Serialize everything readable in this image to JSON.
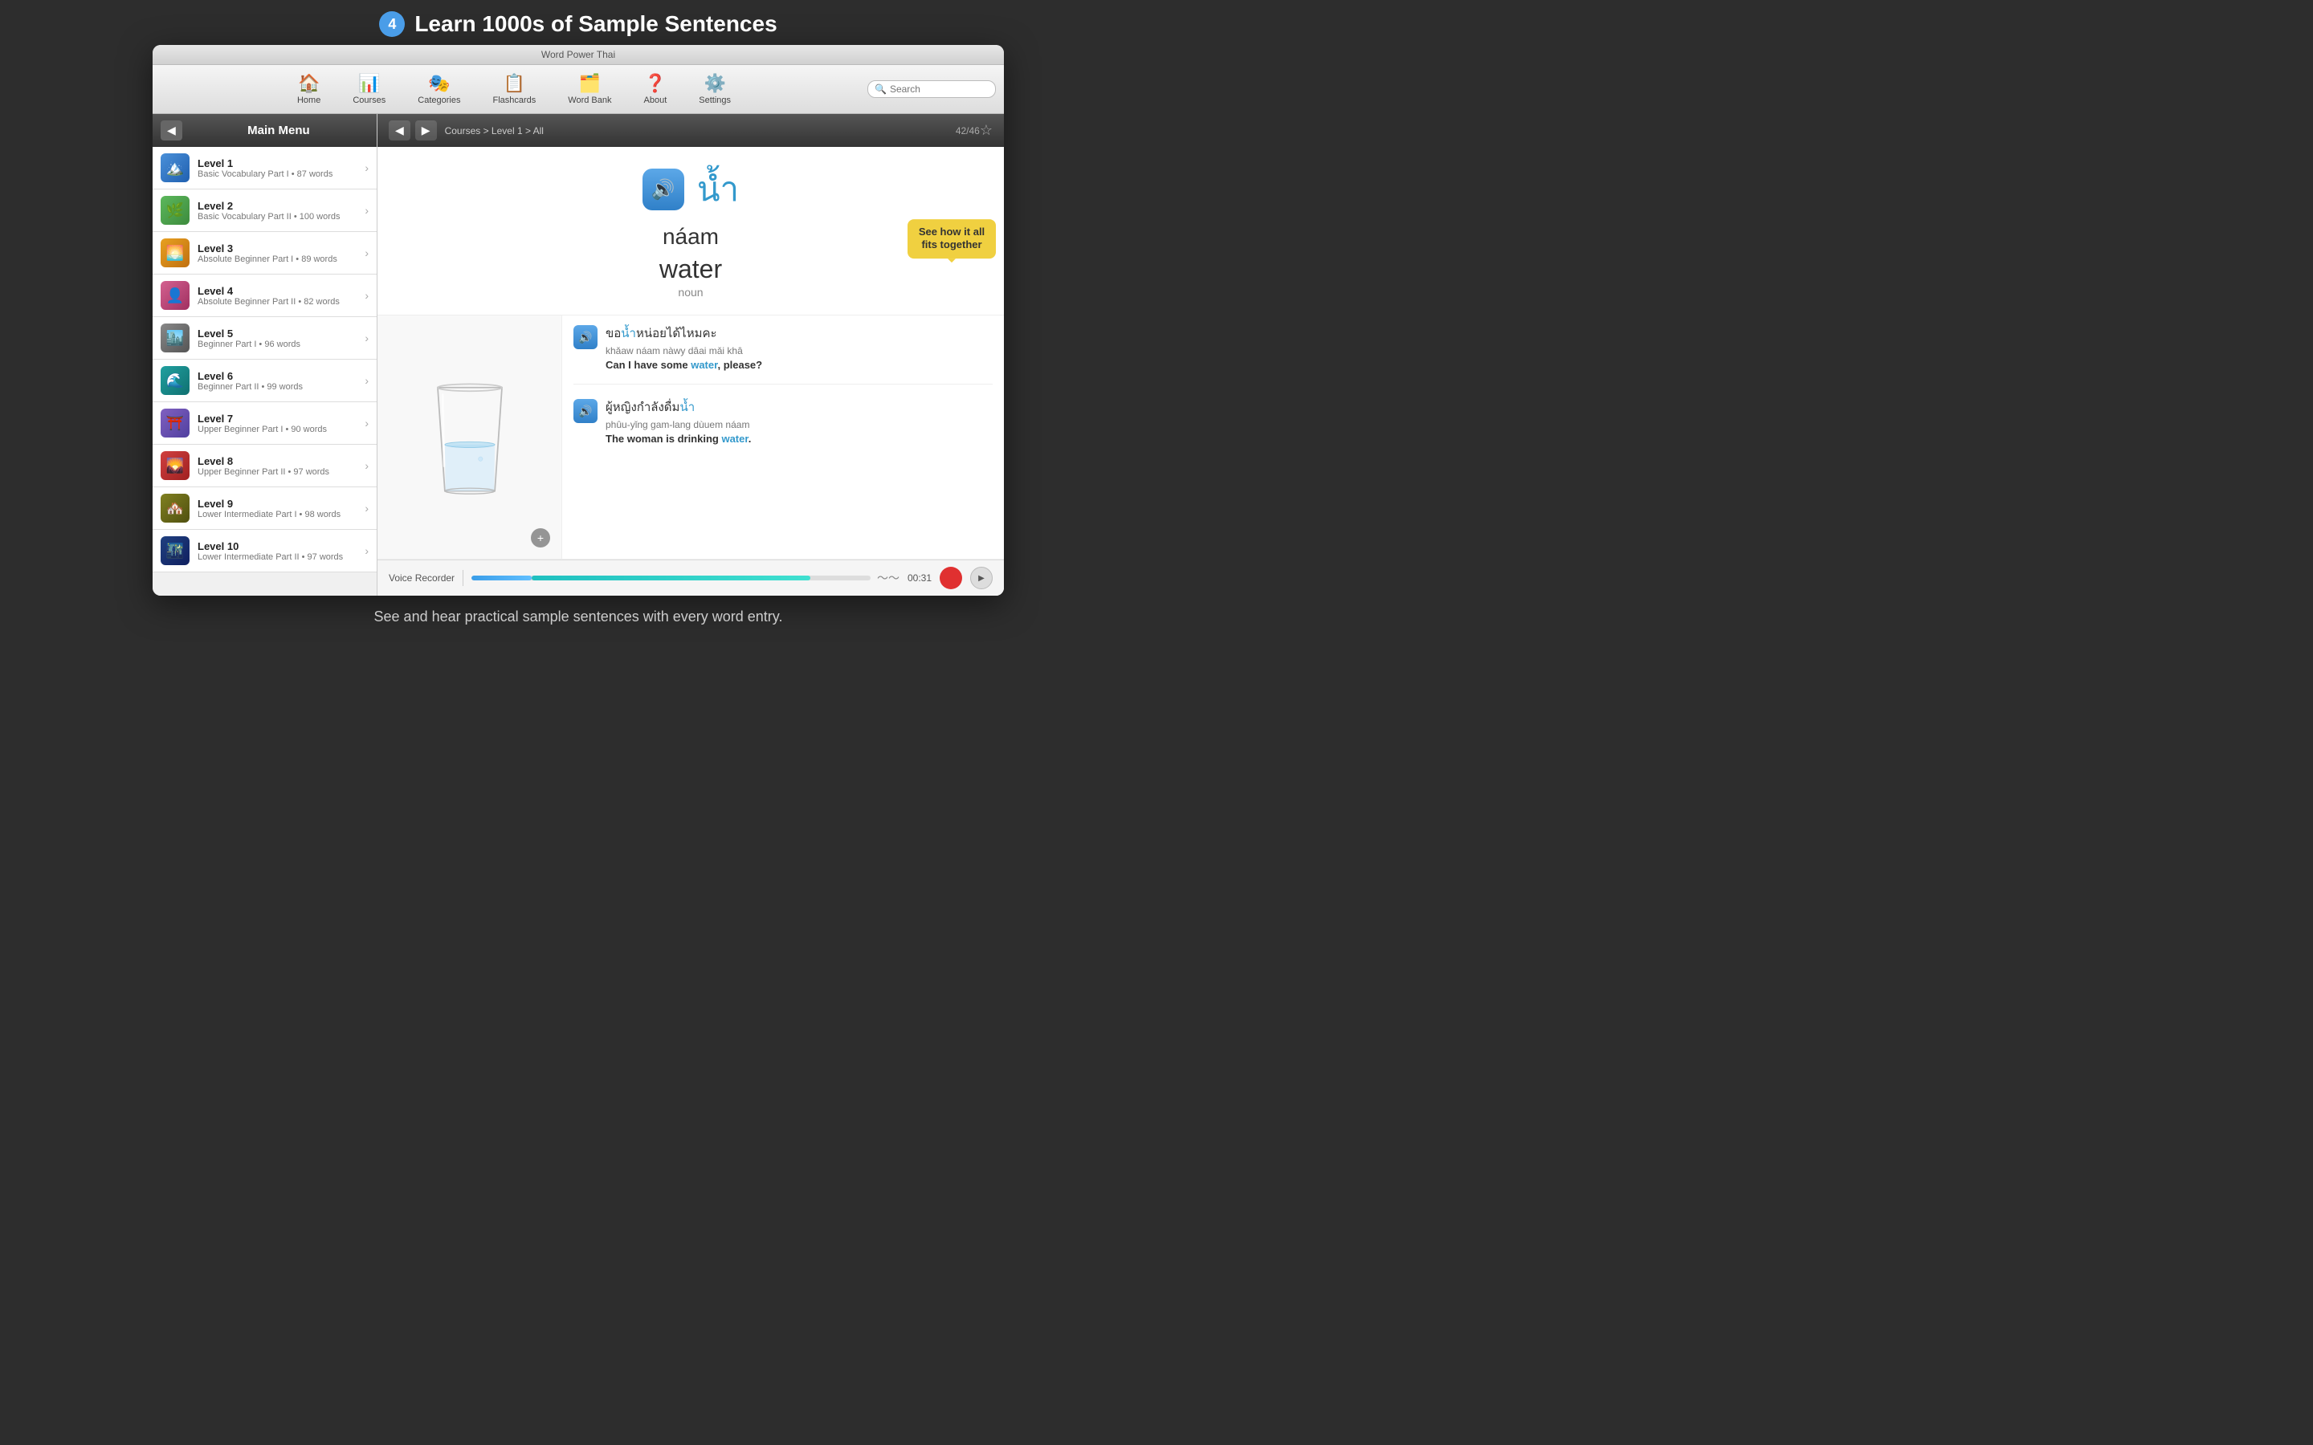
{
  "header": {
    "badge": "4",
    "title": "Learn 1000s of Sample Sentences"
  },
  "app_title": "Word Power Thai",
  "nav": {
    "items": [
      {
        "id": "home",
        "icon": "🏠",
        "label": "Home"
      },
      {
        "id": "courses",
        "icon": "📊",
        "label": "Courses"
      },
      {
        "id": "categories",
        "icon": "🎭",
        "label": "Categories"
      },
      {
        "id": "flashcards",
        "icon": "📋",
        "label": "Flashcards"
      },
      {
        "id": "wordbank",
        "icon": "🗂️",
        "label": "Word Bank"
      },
      {
        "id": "about",
        "icon": "❓",
        "label": "About"
      },
      {
        "id": "settings",
        "icon": "⚙️",
        "label": "Settings"
      }
    ],
    "search_placeholder": "Search"
  },
  "sidebar": {
    "title": "Main Menu",
    "levels": [
      {
        "name": "Level 1",
        "desc": "Basic Vocabulary Part I • 87 words",
        "thumb_class": "thumb-blue",
        "emoji": "🏔️"
      },
      {
        "name": "Level 2",
        "desc": "Basic Vocabulary Part II • 100 words",
        "thumb_class": "thumb-green",
        "emoji": "🌿"
      },
      {
        "name": "Level 3",
        "desc": "Absolute Beginner Part I • 89 words",
        "thumb_class": "thumb-orange",
        "emoji": "🌅"
      },
      {
        "name": "Level 4",
        "desc": "Absolute Beginner Part II • 82 words",
        "thumb_class": "thumb-pink",
        "emoji": "👤"
      },
      {
        "name": "Level 5",
        "desc": "Beginner Part I • 96 words",
        "thumb_class": "thumb-gray",
        "emoji": "🏙️"
      },
      {
        "name": "Level 6",
        "desc": "Beginner Part II • 99 words",
        "thumb_class": "thumb-teal",
        "emoji": "🌊"
      },
      {
        "name": "Level 7",
        "desc": "Upper Beginner Part I • 90 words",
        "thumb_class": "thumb-purple",
        "emoji": "⛩️"
      },
      {
        "name": "Level 8",
        "desc": "Upper Beginner Part II • 97 words",
        "thumb_class": "thumb-red",
        "emoji": "🌄"
      },
      {
        "name": "Level 9",
        "desc": "Lower Intermediate Part I • 98 words",
        "thumb_class": "thumb-olive",
        "emoji": "🏘️"
      },
      {
        "name": "Level 10",
        "desc": "Lower Intermediate Part II • 97 words",
        "thumb_class": "thumb-darkblue",
        "emoji": "🌃"
      }
    ]
  },
  "content": {
    "breadcrumb": "Courses > Level 1 > All",
    "word_count": "42/46",
    "thai_word": "น้ำ",
    "romanized": "náam",
    "english": "water",
    "word_type": "noun",
    "tooltip": "See how it all fits together",
    "sentences": [
      {
        "thai": "ขอน้ำหน่อยได้ไหมคะ",
        "thai_before": "ขอ",
        "thai_highlight": "น้ำ",
        "thai_after": "หน่อยได้ไหมคะ",
        "romanized": "khǎaw náam nàwy dâai mǎi khâ",
        "english_before": "Can I have some ",
        "english_highlight": "water",
        "english_after": ", please?"
      },
      {
        "thai": "ผู้หญิงกำลังดื่มน้ำ",
        "thai_before": "ผู้หญิงกำลังดื่ม",
        "thai_highlight": "น้ำ",
        "thai_after": "",
        "romanized": "phûu-yǐng gam-lang dùuem náam",
        "english_before": "The woman is drinking ",
        "english_highlight": "water",
        "english_after": "."
      }
    ],
    "voice_recorder": {
      "label": "Voice Recorder",
      "time": "00:31"
    }
  },
  "footer": {
    "caption": "See and hear practical sample sentences with every word entry."
  }
}
